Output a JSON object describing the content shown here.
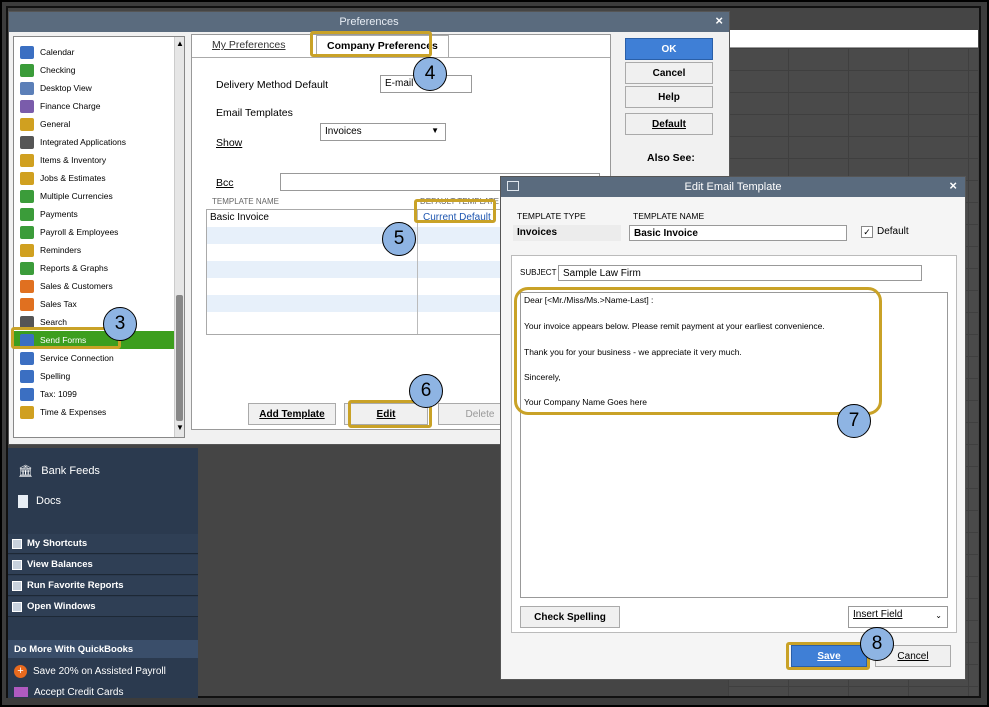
{
  "preferences": {
    "title": "Preferences",
    "close": "×",
    "categories": [
      {
        "label": "Calendar",
        "icon": "calendar-icon",
        "color": "#3b6fc2"
      },
      {
        "label": "Checking",
        "icon": "checking-icon",
        "color": "#3b9c3a"
      },
      {
        "label": "Desktop View",
        "icon": "desktop-view-icon",
        "color": "#5b7fb8"
      },
      {
        "label": "Finance Charge",
        "icon": "finance-charge-icon",
        "color": "#7a5cab"
      },
      {
        "label": "General",
        "icon": "general-icon",
        "color": "#d0a020"
      },
      {
        "label": "Integrated Applications",
        "icon": "integrated-apps-icon",
        "color": "#555555"
      },
      {
        "label": "Items & Inventory",
        "icon": "items-icon",
        "color": "#d0a020"
      },
      {
        "label": "Jobs & Estimates",
        "icon": "jobs-icon",
        "color": "#d0a020"
      },
      {
        "label": "Multiple Currencies",
        "icon": "currencies-icon",
        "color": "#3b9c3a"
      },
      {
        "label": "Payments",
        "icon": "payments-icon",
        "color": "#3b9c3a"
      },
      {
        "label": "Payroll & Employees",
        "icon": "payroll-icon",
        "color": "#3b9c3a"
      },
      {
        "label": "Reminders",
        "icon": "reminders-icon",
        "color": "#d0a020"
      },
      {
        "label": "Reports & Graphs",
        "icon": "reports-icon",
        "color": "#3b9c3a"
      },
      {
        "label": "Sales & Customers",
        "icon": "sales-icon",
        "color": "#e07020"
      },
      {
        "label": "Sales Tax",
        "icon": "sales-tax-icon",
        "color": "#e07020"
      },
      {
        "label": "Search",
        "icon": "search-icon",
        "color": "#555555"
      },
      {
        "label": "Send Forms",
        "icon": "send-forms-icon",
        "color": "#3b6fc2"
      },
      {
        "label": "Service Connection",
        "icon": "service-connection-icon",
        "color": "#3b6fc2"
      },
      {
        "label": "Spelling",
        "icon": "spelling-icon",
        "color": "#3b6fc2"
      },
      {
        "label": "Tax: 1099",
        "icon": "tax-1099-icon",
        "color": "#3b6fc2"
      },
      {
        "label": "Time & Expenses",
        "icon": "time-icon",
        "color": "#d0a020"
      }
    ],
    "selected_category": "Send Forms",
    "tab_my": "My Preferences",
    "tab_company": "Company Preferences",
    "delivery_label": "Delivery Method Default",
    "delivery_value": "E-mail",
    "email_templates_label": "Email Templates",
    "show_label": "Show",
    "show_value": "Invoices",
    "bcc_label": "Bcc",
    "col_template_name": "TEMPLATE NAME",
    "col_default_template": "DEFAULT TEMPLATE",
    "row_name": "Basic Invoice",
    "row_default": "Current Default",
    "add_template": "Add Template",
    "edit": "Edit",
    "delete": "Delete",
    "ok": "OK",
    "cancel": "Cancel",
    "help": "Help",
    "default": "Default",
    "also_see": "Also See:"
  },
  "edit_template": {
    "title": "Edit Email Template",
    "close": "×",
    "type_label": "TEMPLATE TYPE",
    "name_label": "TEMPLATE NAME",
    "type_value": "Invoices",
    "name_value": "Basic Invoice",
    "default_label": "Default",
    "default_checked": "✓",
    "subject_label": "SUBJECT",
    "subject_value": "Sample Law Firm",
    "message_lines": [
      "Dear [<Mr./Miss/Ms.>Name-Last] :",
      "Your invoice appears below.  Please remit payment at your earliest convenience.",
      "Thank you for your business - we appreciate it very much.",
      "Sincerely,",
      "Your Company Name Goes here"
    ],
    "check_spelling": "Check Spelling",
    "insert_field": "Insert Field",
    "save": "Save",
    "cancel": "Cancel"
  },
  "left_nav": {
    "bank_feeds": "Bank Feeds",
    "docs": "Docs",
    "my_shortcuts": "My Shortcuts",
    "view_balances": "View Balances",
    "run_reports": "Run Favorite Reports",
    "open_windows": "Open Windows",
    "do_more": "Do More With QuickBooks",
    "promo_payroll": "Save 20% on Assisted Payroll",
    "promo_cards": "Accept Credit Cards"
  },
  "callouts": [
    "3",
    "4",
    "5",
    "6",
    "7",
    "8"
  ],
  "colors": {
    "highlight": "#c9a227",
    "callout_fill": "#8eb4e3",
    "selected_green": "#3c9e1e",
    "ok_blue": "#3f7fd6"
  }
}
